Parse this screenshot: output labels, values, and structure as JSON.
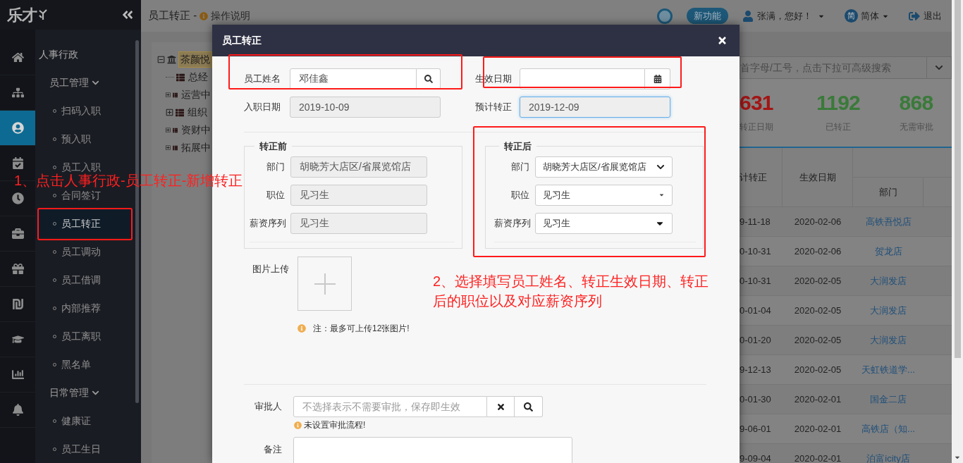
{
  "logo": {
    "text": "乐才"
  },
  "rail": [
    {
      "selected": false
    },
    {
      "selected": false
    },
    {
      "selected": true
    },
    {
      "selected": false
    },
    {
      "selected": false
    },
    {
      "selected": false
    },
    {
      "selected": false
    },
    {
      "selected": false
    },
    {
      "selected": false
    },
    {
      "selected": false
    },
    {
      "selected": false
    }
  ],
  "menu": {
    "section": "人事行政",
    "groups": [
      {
        "label": "员工管理",
        "expanded": true,
        "items": [
          {
            "label": "扫码入职",
            "selected": false
          },
          {
            "label": "预入职",
            "selected": false
          },
          {
            "label": "员工入职",
            "selected": false
          },
          {
            "label": "合同签订",
            "selected": false
          },
          {
            "label": "员工转正",
            "selected": true
          },
          {
            "label": "员工调动",
            "selected": false
          },
          {
            "label": "员工借调",
            "selected": false
          },
          {
            "label": "内部推荐",
            "selected": false
          },
          {
            "label": "员工离职",
            "selected": false
          },
          {
            "label": "黑名单",
            "selected": false
          }
        ]
      },
      {
        "label": "日常管理",
        "expanded": true,
        "items": [
          {
            "label": "健康证",
            "selected": false
          },
          {
            "label": "员工生日",
            "selected": false
          }
        ]
      }
    ]
  },
  "header": {
    "page_title": "员工转正 -",
    "help_link": "操作说明",
    "badge": "新功能",
    "user": "张满，您好！",
    "language_badge": "简",
    "language": "简体",
    "logout": "退出"
  },
  "tree": [
    {
      "label": "茶颜悦",
      "selected": true,
      "expanded": true,
      "children": [
        {
          "label": "总经",
          "selected": false
        },
        {
          "label": "运营中",
          "selected": false,
          "expanded": false
        },
        {
          "label": "组织",
          "selected": false,
          "expanded": false
        },
        {
          "label": "资财中",
          "selected": false,
          "expanded": false
        },
        {
          "label": "拓展中",
          "selected": false,
          "expanded": false
        }
      ]
    }
  ],
  "search": {
    "placeholder": "首字母/工号，点击下拉可高级搜索"
  },
  "stats": [
    {
      "value": "631",
      "label": "转正日期",
      "color": "#a31515"
    },
    {
      "value": "1192",
      "label": "已转正",
      "color": "#3a7a3a"
    },
    {
      "value": "868",
      "label": "无需审批",
      "color": "#3a7a3a"
    }
  ],
  "table": {
    "columns": [
      "计转正",
      "生效日期",
      "部门"
    ],
    "rows": [
      {
        "cells": [
          "9-11-18",
          "2020-02-06",
          "高铁吾悦店"
        ]
      },
      {
        "cells": [
          "0-10-31",
          "2020-02-06",
          "贺龙店"
        ]
      },
      {
        "cells": [
          "0-10-31",
          "2020-02-05",
          "大润发店"
        ]
      },
      {
        "cells": [
          "0-01-04",
          "2020-02-05",
          "大润发店"
        ]
      },
      {
        "cells": [
          "0-01-20",
          "2020-02-05",
          "大润发店"
        ]
      },
      {
        "cells": [
          "9-12-13",
          "2020-02-05",
          "天虹铁道学..."
        ]
      },
      {
        "cells": [
          "0-01-30",
          "2020-02-01",
          "国金二店"
        ]
      },
      {
        "cells": [
          "9-06-01",
          "2020-02-01",
          "高铁店（知..."
        ]
      },
      {
        "cells": [
          "9-09-04",
          "2020-02-01",
          "泊富icity店"
        ]
      }
    ]
  },
  "dialog": {
    "title": "员工转正",
    "employee": {
      "label": "员工姓名",
      "value": "邓佳鑫"
    },
    "effective_date": {
      "label": "生效日期"
    },
    "hire_date": {
      "label": "入职日期",
      "value": "2019-10-09",
      "disabled": true,
      "focused": false
    },
    "expected": {
      "label": "预计转正",
      "value": "2019-12-09",
      "disabled": true,
      "focused": true
    },
    "before": {
      "legend": "转正前",
      "rows": [
        {
          "label": "部门",
          "value": "胡晓芳大店区/省展览馆店"
        },
        {
          "label": "职位",
          "value": "见习生"
        },
        {
          "label": "薪资序列",
          "value": "见习生"
        }
      ]
    },
    "after": {
      "legend": "转正后",
      "rows": [
        {
          "label": "部门",
          "value": "胡晓芳大店区/省展览馆店",
          "kind": "chevron"
        },
        {
          "label": "职位",
          "value": "见习生",
          "kind": "small-caret"
        },
        {
          "label": "薪资序列",
          "value": "见习生",
          "kind": "caret"
        }
      ]
    },
    "upload": {
      "label": "图片上传",
      "note": "注：最多可上传12张图片!"
    },
    "approver": {
      "label": "审批人",
      "placeholder": "不选择表示不需要审批，保存即生效",
      "warning": "未设置审批流程!"
    },
    "remark": {
      "label": "备注"
    }
  },
  "annotations": [
    {
      "text": "1、点击人事行政-员工转正-新增转正"
    },
    {
      "text": "2、选择填写员工姓名、转正生效日期、转正后的职位以及对应薪资序列"
    }
  ]
}
